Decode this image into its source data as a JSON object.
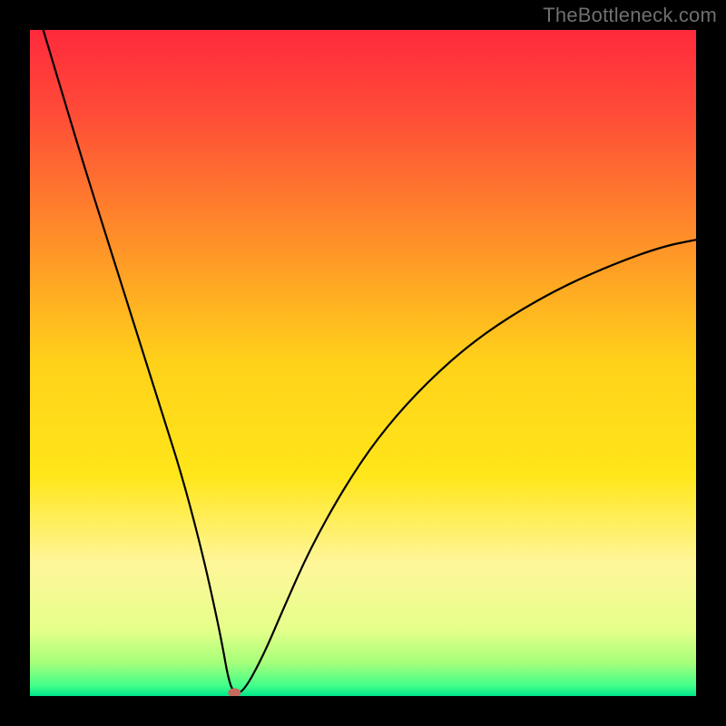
{
  "watermark": "TheBottleneck.com",
  "chart_data": {
    "type": "line",
    "title": "",
    "xlabel": "",
    "ylabel": "",
    "xlim": [
      0,
      100
    ],
    "ylim": [
      0,
      100
    ],
    "background_gradient": {
      "stops": [
        {
          "pos": 0.0,
          "color": "#ff2a3c"
        },
        {
          "pos": 0.12,
          "color": "#ff4a38"
        },
        {
          "pos": 0.3,
          "color": "#ff8a2a"
        },
        {
          "pos": 0.5,
          "color": "#ffd21a"
        },
        {
          "pos": 0.67,
          "color": "#ffe61a"
        },
        {
          "pos": 0.8,
          "color": "#fff69a"
        },
        {
          "pos": 0.9,
          "color": "#e6ff8a"
        },
        {
          "pos": 0.95,
          "color": "#a6ff7a"
        },
        {
          "pos": 0.985,
          "color": "#40ff8a"
        },
        {
          "pos": 1.0,
          "color": "#00e58a"
        }
      ]
    },
    "series": [
      {
        "name": "bottleneck-curve",
        "x": [
          2.0,
          5.0,
          8.0,
          11.0,
          14.0,
          17.0,
          20.0,
          23.0,
          26.0,
          28.0,
          29.0,
          29.7,
          30.5,
          32.0,
          35.0,
          38.0,
          42.0,
          47.0,
          52.0,
          58.0,
          65.0,
          72.0,
          80.0,
          88.0,
          95.0,
          100.0
        ],
        "y": [
          100.0,
          90.0,
          80.0,
          70.5,
          61.0,
          51.5,
          42.0,
          32.5,
          21.0,
          12.0,
          7.0,
          3.0,
          0.5,
          0.5,
          6.0,
          13.0,
          22.0,
          31.0,
          38.5,
          45.5,
          52.0,
          57.0,
          61.5,
          65.0,
          67.5,
          68.5
        ]
      }
    ],
    "marker": {
      "name": "min-point",
      "x": 30.7,
      "y": 0.5,
      "color": "#c46a5c",
      "rx": 7,
      "ry": 5
    }
  }
}
